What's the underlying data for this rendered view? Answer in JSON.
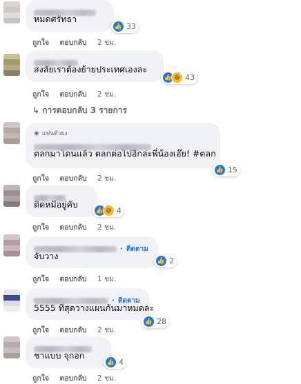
{
  "actions": {
    "like": "ถูกใจ",
    "reply": "ตอบกลับ"
  },
  "comments": [
    {
      "text": "หมดศรัทธา",
      "reactions": "33",
      "time": "2 ชม."
    },
    {
      "text": "สงสัยเราต้องย้ายประเทศเองละ",
      "reactions": "43",
      "time": "2 ชม.",
      "view_replies": "การตอบกลับ 3 รายการ"
    },
    {
      "badge": "แฟนตัวยง",
      "text": "ตลกมาโดนแล้ว ตลกต่อไปอีกล่ะพี่น้องเอ๊ย! #ตลก",
      "reactions": "15",
      "time": "2 ชม."
    },
    {
      "text": "ติดหมือยู่คับ",
      "reactions": "4",
      "time": "2 ชม."
    },
    {
      "follow": "ติดตาม",
      "text": "จับวาง",
      "reactions": "2",
      "time": "1 ชม."
    },
    {
      "follow": "ติดตาม",
      "text": "5555 ที่สุดวางแผนกันมาหมดละ",
      "reactions": "28",
      "time": "2 ชม."
    },
    {
      "text": "ชาแบบ จุกอก",
      "reactions": "4",
      "time": "2 ชม."
    }
  ],
  "icons": {
    "like": "thumbs-up-icon",
    "haha": "haha-icon",
    "reply_arrow": "reply-arrow-icon",
    "badge": "diamond-icon"
  },
  "colors": {
    "link": "#216fdb",
    "like": "#1877f2",
    "bubble": "#f0f2f5",
    "meta": "#65676b"
  }
}
